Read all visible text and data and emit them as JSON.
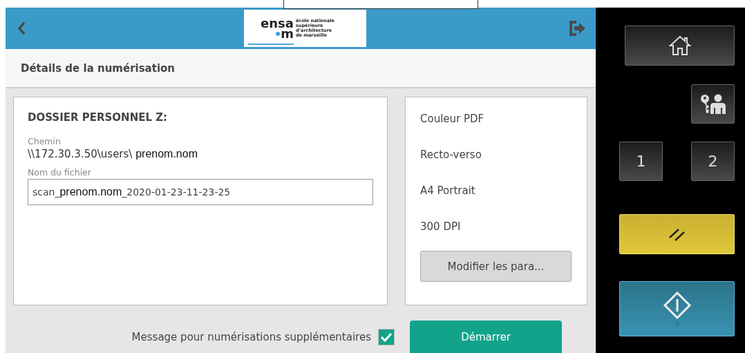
{
  "header": {
    "logo": {
      "word_top": "ensa",
      "word_bottom": "m",
      "lines": [
        "école nationale",
        "supérieure",
        "d’architecture",
        "de marseille"
      ]
    }
  },
  "page_title": "Détails de la numérisation",
  "destination": {
    "title": "DOSSIER PERSONNEL Z:",
    "path_label": "Chemin",
    "path_prefix": "\\\\172.30.3.50\\users\\",
    "path_user": "prenom.nom",
    "filename_label": "Nom du fichier",
    "filename_prefix": "scan_",
    "filename_user": "prenom.nom",
    "filename_suffix": "_2020-01-23-11-23-25"
  },
  "settings": [
    "Couleur PDF",
    "Recto-verso",
    "A4 Portrait",
    "300 DPI"
  ],
  "modify_button": "Modifier les para...",
  "extra_scans": {
    "label": "Message pour numérisations supplémentaires",
    "checked": true
  },
  "start_button": "Démarrer",
  "panel": {
    "keys": [
      {
        "label": "1"
      },
      {
        "label": "2"
      }
    ]
  }
}
